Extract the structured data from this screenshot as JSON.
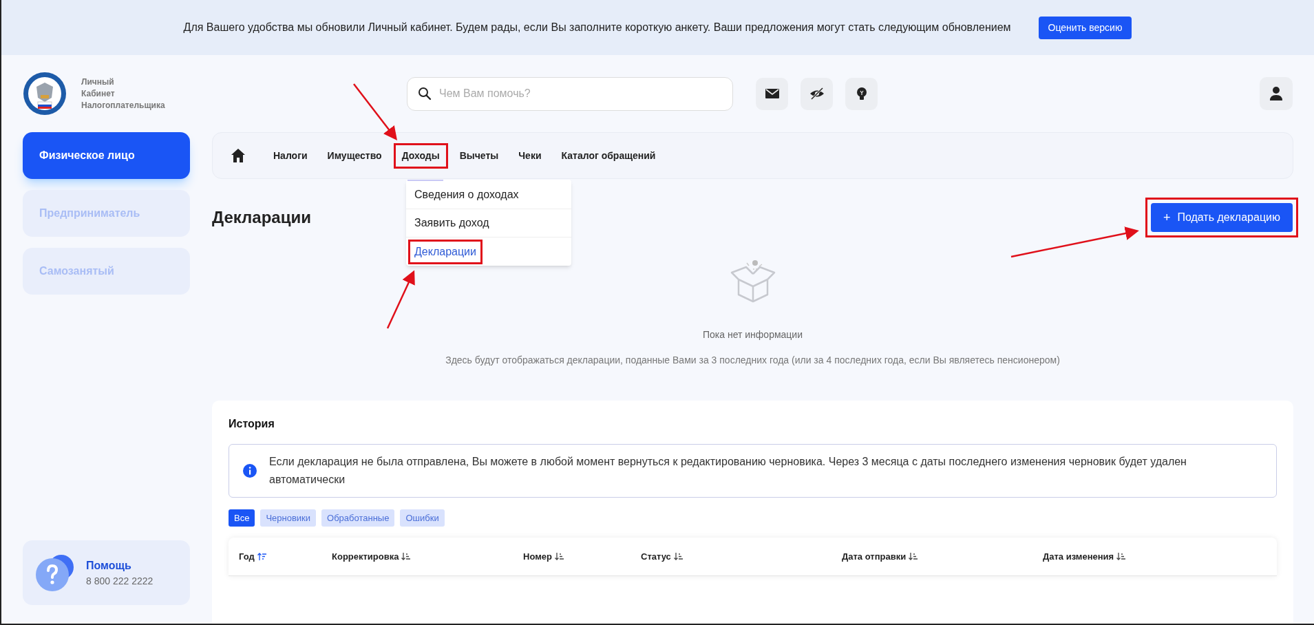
{
  "banner": {
    "text": "Для Вашего удобства мы обновили Личный кабинет. Будем рады, если Вы заполните короткую анкету. Ваши предложения могут стать следующим обновлением",
    "button": "Оценить версию"
  },
  "logo": {
    "lines": [
      "Личный",
      "Кабинет",
      "Налогоплательщика"
    ]
  },
  "search": {
    "placeholder": "Чем Вам помочь?"
  },
  "sidebar": {
    "items": [
      {
        "label": "Физическое лицо",
        "selected": true
      },
      {
        "label": "Предприниматель",
        "selected": false
      },
      {
        "label": "Самозанятый",
        "selected": false
      }
    ],
    "help": {
      "title": "Помощь",
      "phone": "8 800 222 2222"
    }
  },
  "nav": {
    "items": [
      {
        "label": "Налоги",
        "highlighted": false
      },
      {
        "label": "Имущество",
        "highlighted": false
      },
      {
        "label": "Доходы",
        "highlighted": true
      },
      {
        "label": "Вычеты",
        "highlighted": false
      },
      {
        "label": "Чеки",
        "highlighted": false
      },
      {
        "label": "Каталог обращений",
        "highlighted": false
      }
    ],
    "dropdown": [
      {
        "label": "Сведения о доходах",
        "selected": false,
        "highlighted": false
      },
      {
        "label": "Заявить доход",
        "selected": false,
        "highlighted": false
      },
      {
        "label": "Декларации",
        "selected": true,
        "highlighted": true
      }
    ]
  },
  "page": {
    "title": "Декларации",
    "action": {
      "icon": "+",
      "label": "Подать декларацию",
      "highlighted": true
    },
    "empty": {
      "title": "Пока нет информации",
      "text": "Здесь будут отображаться декларации, поданные Вами за 3 последних года (или за 4 последних года, если Вы являетесь пенсионером)"
    }
  },
  "history": {
    "title": "История",
    "info": "Если декларация не была отправлена, Вы можете в любой момент вернуться к редактированию черновика. Через 3 месяца с даты последнего изменения черновик будет удален автоматически",
    "filters": [
      {
        "label": "Все",
        "selected": true
      },
      {
        "label": "Черновики",
        "selected": false
      },
      {
        "label": "Обработанные",
        "selected": false
      },
      {
        "label": "Ошибки",
        "selected": false
      }
    ],
    "columns": [
      {
        "label": "Год",
        "sorted": true
      },
      {
        "label": "Корректировка",
        "sorted": false
      },
      {
        "label": "Номер",
        "sorted": false
      },
      {
        "label": "Статус",
        "sorted": false
      },
      {
        "label": "Дата отправки",
        "sorted": false
      },
      {
        "label": "Дата изменения",
        "sorted": false
      }
    ]
  }
}
